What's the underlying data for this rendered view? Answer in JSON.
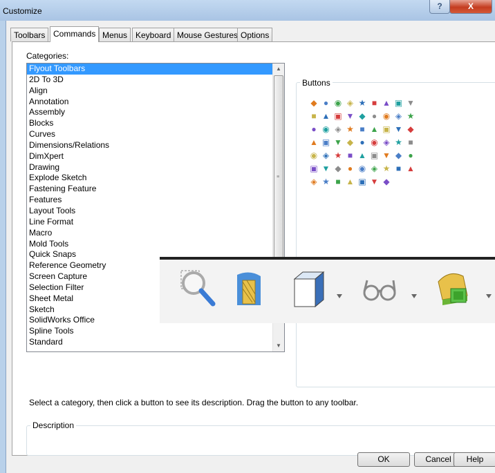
{
  "window": {
    "title": "Customize",
    "help_glyph": "?",
    "close_glyph": "X"
  },
  "tabs": [
    "Toolbars",
    "Commands",
    "Menus",
    "Keyboard",
    "Mouse Gestures",
    "Options"
  ],
  "active_tab": "Commands",
  "categories_label": "Categories:",
  "categories": [
    "Flyout Toolbars",
    "2D To 3D",
    "Align",
    "Annotation",
    "Assembly",
    "Blocks",
    "Curves",
    "Dimensions/Relations",
    "DimXpert",
    "Drawing",
    "Explode Sketch",
    "Fastening Feature",
    "Features",
    "Layout Tools",
    "Line Format",
    "Macro",
    "Mold Tools",
    "Quick Snaps",
    "Reference Geometry",
    "Screen Capture",
    "Selection Filter",
    "Sheet Metal",
    "Sketch",
    "SolidWorks Office",
    "Spline Tools",
    "Standard"
  ],
  "selected_category": "Flyout Toolbars",
  "buttons_label": "Buttons",
  "hint": "Select a category, then click a button to see its description. Drag the button to any toolbar.",
  "description_label": "Description",
  "actions": {
    "ok": "OK",
    "cancel": "Cancel",
    "help": "Help"
  },
  "colors": {
    "selection": "#3399ff",
    "titlebar": "#b9d1ea",
    "close": "#c43d20"
  }
}
